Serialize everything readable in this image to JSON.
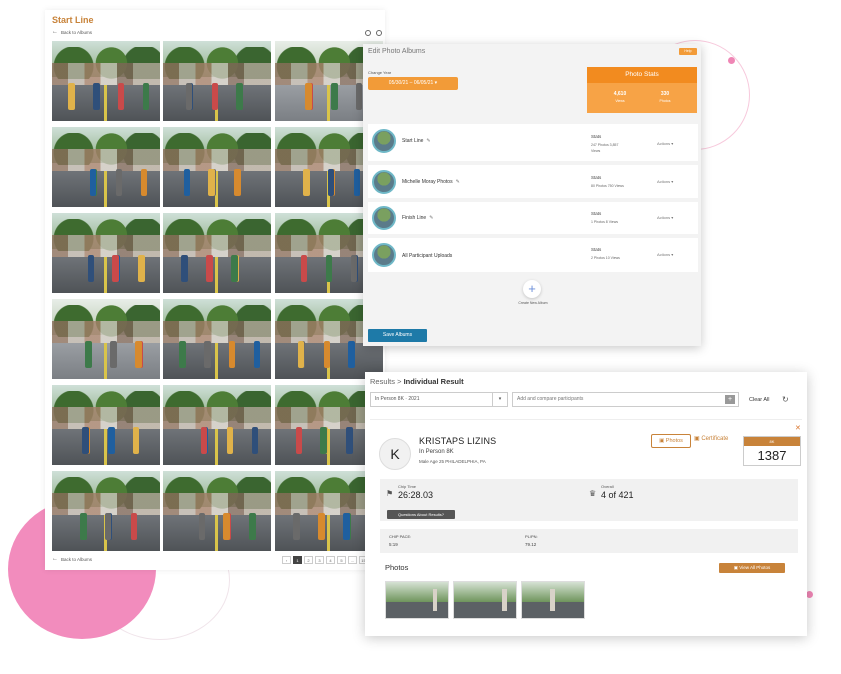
{
  "gallery": {
    "title": "Start Line",
    "back_label": "Back to Albums",
    "pager": [
      "‹",
      "1",
      "2",
      "3",
      "4",
      "5",
      "...",
      "15",
      "›"
    ]
  },
  "albums": {
    "title": "Edit Photo Albums",
    "help_label": "Help",
    "change_year_label": "Change Year",
    "year_range": "05/30/21 – 06/05/21 ▾",
    "photo_stats": {
      "title": "Photo Stats",
      "views_value": "4,610",
      "views_label": "Views",
      "photos_value": "330",
      "photos_label": "Photos"
    },
    "rows": [
      {
        "name": "Start Line",
        "stats_label": "Stats",
        "stats_line1": "247 Photos  3,857",
        "stats_line2": "Views",
        "actions": "Actions ▾"
      },
      {
        "name": "Michelle Moray Photos",
        "stats_label": "Stats",
        "stats_line1": "80 Photos  750 Views",
        "stats_line2": "",
        "actions": "Actions ▾"
      },
      {
        "name": "Finish Line",
        "stats_label": "Stats",
        "stats_line1": "1 Photos  8 Views",
        "stats_line2": "",
        "actions": "Actions ▾"
      },
      {
        "name": "All Participant Uploads",
        "stats_label": "Stats",
        "stats_line1": "2 Photos  10 Views",
        "stats_line2": "",
        "actions": "Actions ▾"
      }
    ],
    "create_label": "Create New Album",
    "save_label": "Save Albums"
  },
  "result": {
    "breadcrumb_prefix": "Results > ",
    "breadcrumb_current": "Individual Result",
    "event_select": "In Person 8K · 2021",
    "compare_placeholder": "Add and compare participants",
    "clear_all": "Clear All",
    "participant": {
      "initial": "K",
      "name": "KRISTAPS LIZINS",
      "event": "In Person 8K",
      "details": "Male   Age 25   PHILADELPHIA, PA"
    },
    "photos_button": "Photos",
    "certificate_button": "Certificate",
    "bib_label": "8K",
    "bib_number": "1387",
    "chip_time_label": "Chip Time",
    "chip_time": "26:28.03",
    "overall_label": "Overall",
    "overall": "4 of 421",
    "questions_button": "Questions About Results?",
    "chip_pace_label": "CHIP PACE:",
    "chip_pace": "5:19",
    "plpn_label": "PL/PN:",
    "plpn": "79.12",
    "photos_heading": "Photos",
    "view_all_photos": "View All Photos"
  },
  "colors": {
    "accent_orange": "#f29b38",
    "brown_accent": "#c8833a",
    "save_blue": "#1e7aa8",
    "pink": "#f28cbd"
  }
}
